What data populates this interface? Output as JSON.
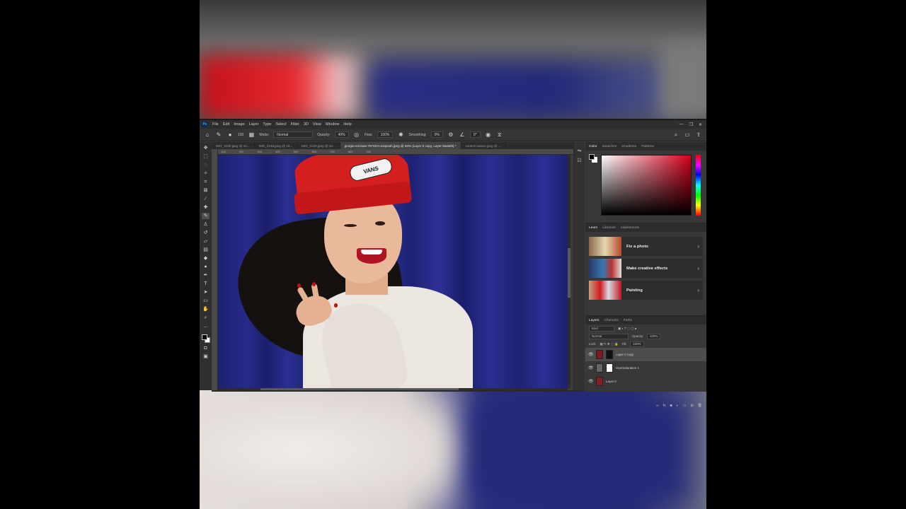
{
  "menubar": {
    "logo": "Ps",
    "items": [
      "File",
      "Edit",
      "Image",
      "Layer",
      "Type",
      "Select",
      "Filter",
      "3D",
      "View",
      "Window",
      "Help"
    ],
    "window_controls": [
      "—",
      "❐",
      "✕"
    ]
  },
  "options_bar": {
    "brush_size": "150",
    "mode_label": "Mode:",
    "mode_value": "Normal",
    "opacity_label": "Opacity:",
    "opacity_value": "40%",
    "flow_label": "Flow:",
    "flow_value": "100%",
    "smoothing_label": "Smoothing:",
    "smoothing_value": "0%",
    "angle_value": "0°"
  },
  "tabs": [
    "IMG_2330.jpeg @ 10...",
    "IMG_2248.jpeg @ 10...",
    "IMG_2120.jpeg @ 10...",
    "giorgio-encinas-787623-unsplash.jpeg @ 50% (Layer 0 copy, Layer Mask/8) *",
    "content-aware.jpeg @ ..."
  ],
  "active_tab_index": 3,
  "ruler_ticks": [
    "100",
    "200",
    "300",
    "400",
    "500",
    "600",
    "700",
    "800",
    "900"
  ],
  "canvas": {
    "beanie_text": "VANS",
    "background_color": "#232885",
    "beanie_color": "#d41e1f"
  },
  "panels": {
    "color_tabs": [
      "Color",
      "Swatches",
      "Gradients",
      "Patterns"
    ],
    "learn_tabs": [
      "Learn",
      "Libraries",
      "Adjustments"
    ],
    "learn_items": [
      {
        "label": "Fix a photo"
      },
      {
        "label": "Make creative effects"
      },
      {
        "label": "Painting"
      }
    ],
    "layers_tabs": [
      "Layers",
      "Channels",
      "Paths"
    ],
    "kind_label": "Kind",
    "blend_mode": "Normal",
    "opacity_label": "Opacity:",
    "opacity_value": "100%",
    "lock_label": "Lock:",
    "fill_label": "Fill:",
    "fill_value": "100%",
    "layers": [
      {
        "name": "Layer 0 copy",
        "selected": true
      },
      {
        "name": "Hue/Saturation 1",
        "selected": false
      },
      {
        "name": "Layer 0",
        "selected": false
      }
    ]
  },
  "icons": {
    "home": "home-icon",
    "brush": "brush-icon",
    "search": "search-icon",
    "eye": "eye-icon"
  }
}
